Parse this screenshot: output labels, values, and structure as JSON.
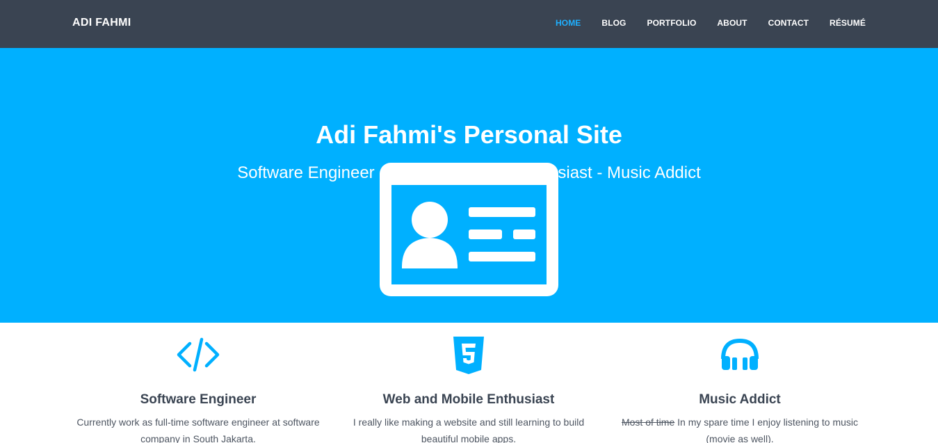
{
  "nav": {
    "brand": "ADI FAHMI",
    "links": [
      "HOME",
      "BLOG",
      "PORTFOLIO",
      "ABOUT",
      "CONTACT",
      "RÉSUMÉ"
    ],
    "active": "HOME",
    "active_color": "#1fb0ff"
  },
  "hero": {
    "title": "Adi Fahmi's Personal Site",
    "subtitle": "Software Engineer - Web and Mobile Enthusiast - Music Addict",
    "icon": "id-card-icon",
    "background": "#00b0ff"
  },
  "features": [
    {
      "icon": "code-icon",
      "title": "Software Engineer",
      "text": "Currently work as full-time software engineer at software company in South Jakarta."
    },
    {
      "icon": "html5-icon",
      "title": "Web and Mobile Enthusiast",
      "text": "I really like making a website and still learning to build beautiful mobile apps."
    },
    {
      "icon": "headphones-icon",
      "title": "Music Addict",
      "text_struck": "Most of time",
      "text": " In my spare time I enjoy listening to music (movie as well)."
    }
  ],
  "colors": {
    "navbar": "#3a4452",
    "accent": "#00b0ff"
  }
}
